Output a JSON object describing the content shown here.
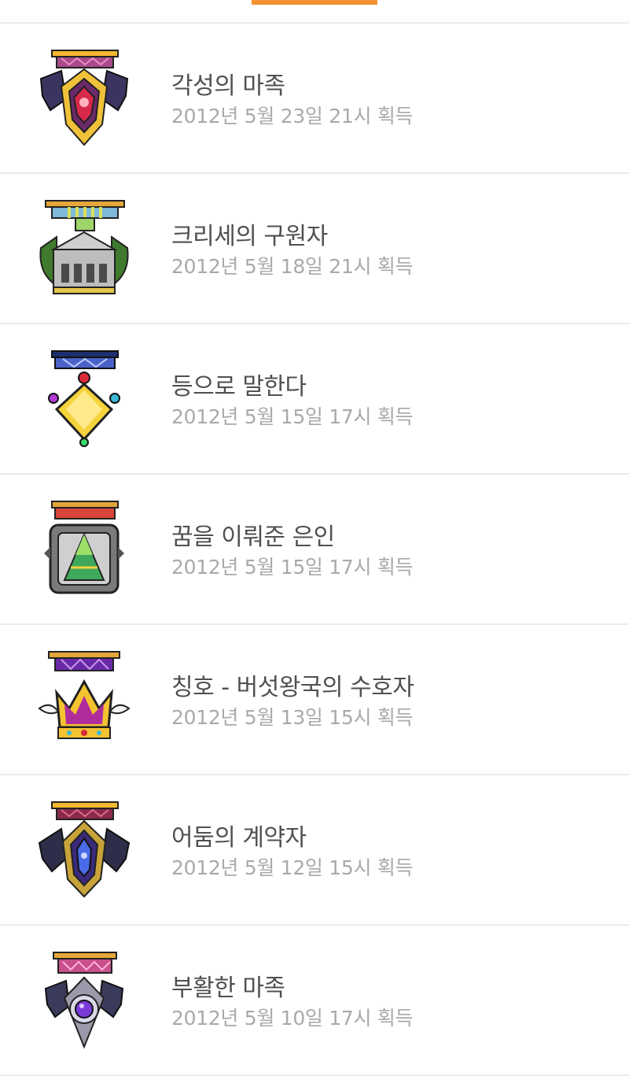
{
  "colors": {
    "accent": "#f39233",
    "title_text": "#505050",
    "date_text": "#a9a9a9",
    "divider": "#ebebeb"
  },
  "medals": [
    {
      "title": "각성의 마족",
      "date": "2012년 5월 23일 21시 획득",
      "icon": "demon-wing-medal-icon"
    },
    {
      "title": "크리세의 구원자",
      "date": "2012년 5월 18일 21시 획득",
      "icon": "temple-medal-icon"
    },
    {
      "title": "등으로 말한다",
      "date": "2012년 5월 15일 17시 획득",
      "icon": "gold-gem-medal-icon"
    },
    {
      "title": "꿈을 이뤄준 은인",
      "date": "2012년 5월 15일 17시 획득",
      "icon": "pyramid-medal-icon"
    },
    {
      "title": "칭호 - 버섯왕국의 수호자",
      "date": "2012년 5월 13일 15시 획득",
      "icon": "crown-medal-icon"
    },
    {
      "title": "어둠의 계약자",
      "date": "2012년 5월 12일 15시 획득",
      "icon": "dark-contract-medal-icon"
    },
    {
      "title": "부활한 마족",
      "date": "2012년 5월 10일 17시 획득",
      "icon": "revived-demon-medal-icon"
    }
  ]
}
